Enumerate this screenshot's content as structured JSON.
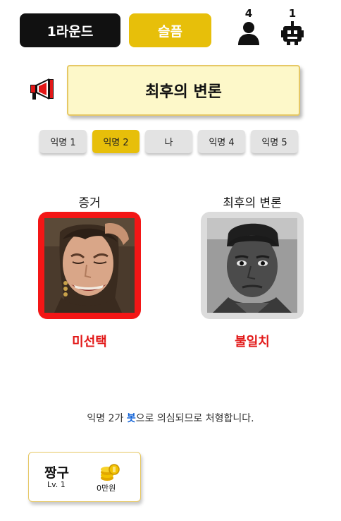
{
  "header": {
    "round_label": "1라운드",
    "sad_label": "슬픔",
    "human_count": "4",
    "bot_count": "1"
  },
  "phase": {
    "title": "최후의 변론"
  },
  "tabs": [
    {
      "label": "익명 1",
      "active": false
    },
    {
      "label": "익명 2",
      "active": true
    },
    {
      "label": "나",
      "active": false
    },
    {
      "label": "익명 4",
      "active": false
    },
    {
      "label": "익명 5",
      "active": false
    }
  ],
  "evidence": {
    "title": "증거",
    "status": "미선택"
  },
  "final_argument": {
    "title": "최후의 변론",
    "status": "불일치"
  },
  "verdict": {
    "prefix": "익명 2가 ",
    "highlight": "봇",
    "suffix": "으로 의심되므로 처형합니다."
  },
  "profile": {
    "name": "짱구",
    "level": "Lv. 1",
    "money": "0만원"
  },
  "colors": {
    "accent_yellow": "#e7bf0a",
    "alert_red": "#e21717",
    "highlight_blue": "#1565d8"
  },
  "icons": [
    "human-icon",
    "robot-icon",
    "megaphone-icon",
    "coin-icon"
  ]
}
